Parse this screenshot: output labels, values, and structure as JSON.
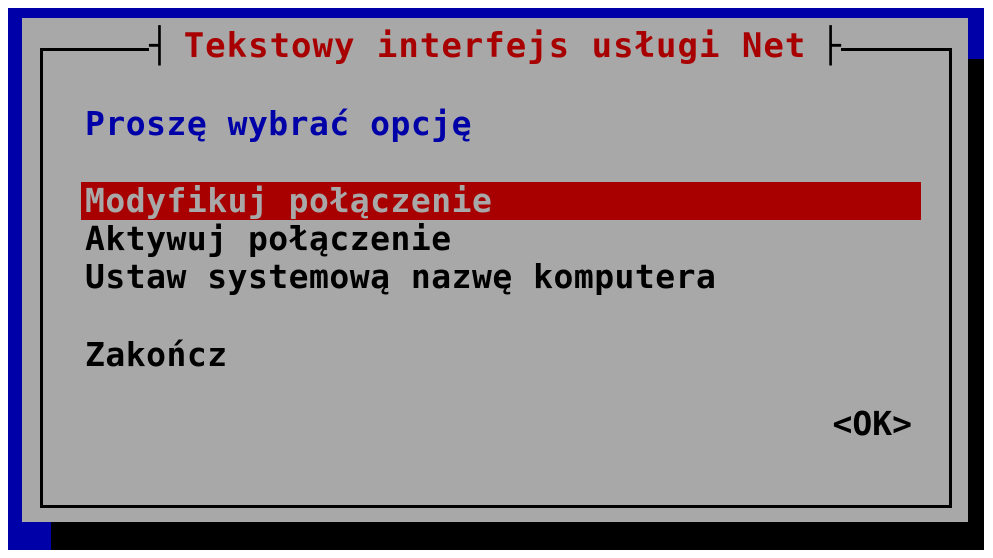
{
  "dialog": {
    "title": "Tekstowy interfejs usługi Net",
    "prompt": "Proszę wybrać opcję",
    "menu": {
      "items": [
        {
          "label": "Modyfikuj połączenie",
          "selected": true
        },
        {
          "label": "Aktywuj połączenie",
          "selected": false
        },
        {
          "label": "Ustaw systemową nazwę komputera",
          "selected": false
        }
      ],
      "quit_label": "Zakończ"
    },
    "ok_label": "<OK>"
  },
  "colors": {
    "background": "#0000a8",
    "dialog": "#a8a8a8",
    "accent": "#a80000",
    "prompt": "#0000a8",
    "shadow": "#000000"
  }
}
